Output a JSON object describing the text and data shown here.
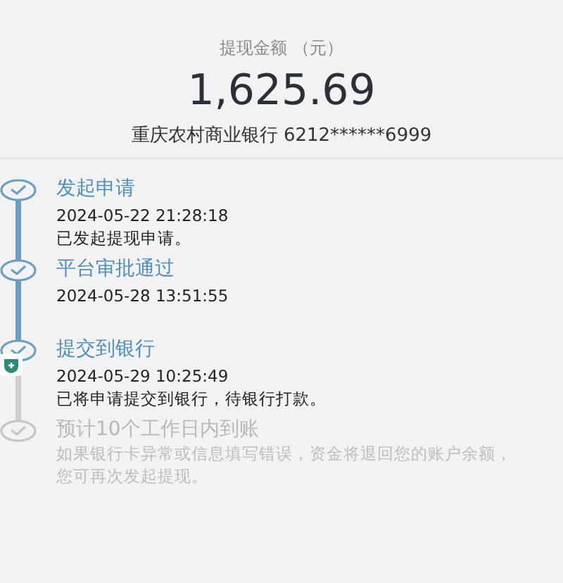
{
  "summary": {
    "label": "提现金额 （元）",
    "amount": "1,625.69",
    "account": "重庆农村商业银行 6212******6999"
  },
  "steps": [
    {
      "title": "发起申请",
      "time": "2024-05-22 21:28:18",
      "note": "已发起提现申请。",
      "done": true
    },
    {
      "title": "平台审批通过",
      "time": "2024-05-28 13:51:55",
      "done": true
    },
    {
      "title": "提交到银行",
      "time": "2024-05-29 10:25:49",
      "note": "已将申请提交到银行，待银行打款。",
      "done": true
    },
    {
      "title": "预计10个工作日内到账",
      "note": "如果银行卡异常或信息填写错误，资金将退回您的账户余额，您可再次发起提现。",
      "done": false
    }
  ]
}
